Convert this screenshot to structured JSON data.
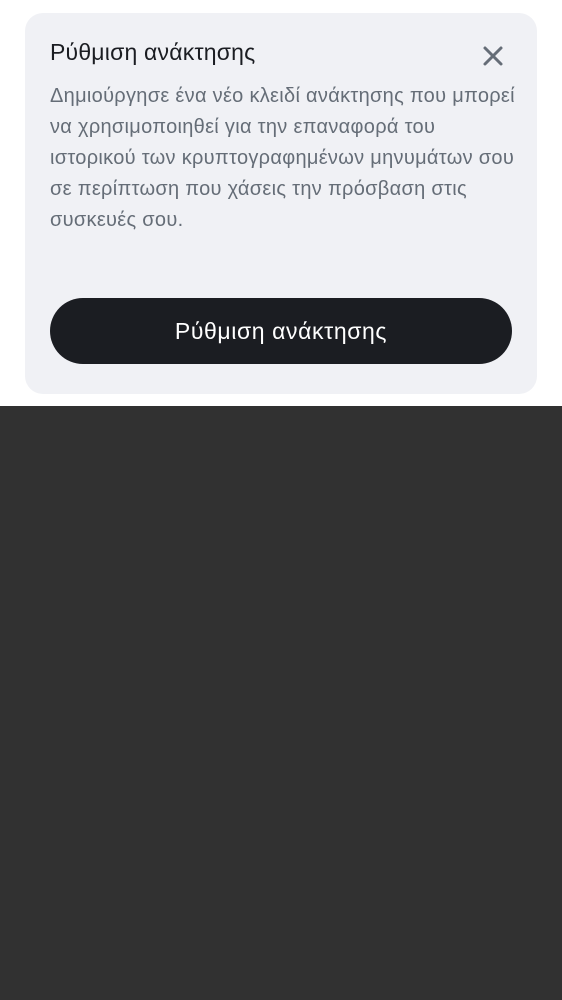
{
  "recovery_card": {
    "title": "Ρύθμιση ανάκτησης",
    "description": "Δημιούργησε ένα νέο κλειδί ανάκτησης που μπορεί να χρησιμοποιηθεί για την επαναφορά του ιστορικού των κρυπτογραφημένων μηνυμάτων σου σε περίπτωση που χάσεις την πρόσβαση στις συσκευές σου.",
    "button_label": "Ρύθμιση ανάκτησης",
    "close_icon": "close-icon"
  },
  "colors": {
    "card_background": "#f0f1f5",
    "title_text": "#1b1d22",
    "description_text": "#656d77",
    "button_background": "#1b1d22",
    "button_text": "#ffffff",
    "overlay": "#313131"
  }
}
